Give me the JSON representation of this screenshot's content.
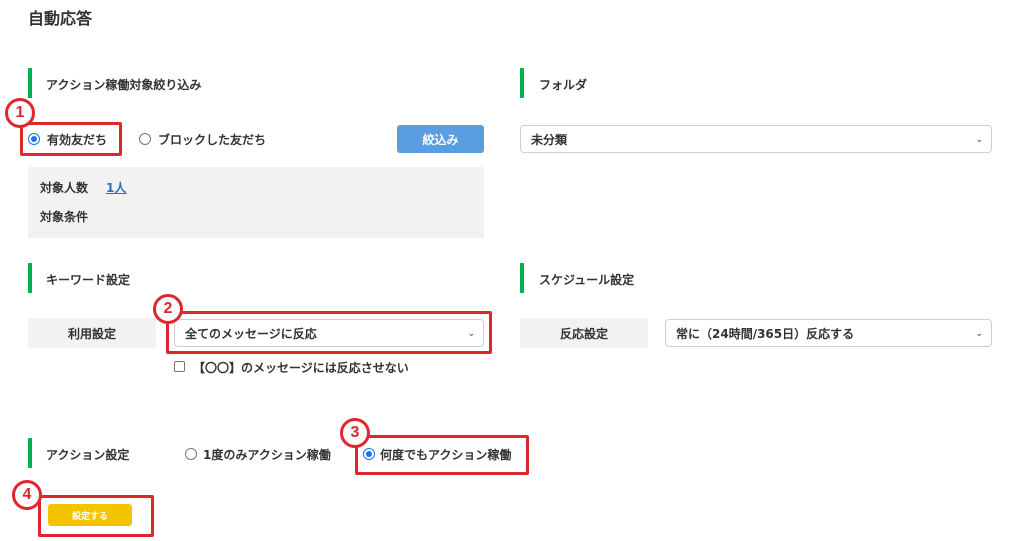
{
  "page": {
    "title": "自動応答"
  },
  "filter_section": {
    "title": "アクション稼働対象絞り込み",
    "radio_valid_friends": "有効友だち",
    "radio_blocked_friends": "ブロックした友だち",
    "filter_button": "絞込み",
    "target_count_label": "対象人数",
    "target_count_value": "1人",
    "target_condition_label": "対象条件"
  },
  "folder_section": {
    "title": "フォルダ",
    "selected": "未分類"
  },
  "keyword_section": {
    "title": "キーワード設定",
    "usage_label": "利用設定",
    "selected": "全てのメッセージに反応",
    "checkbox_label": "【〇〇】のメッセージには反応させない"
  },
  "schedule_section": {
    "title": "スケジュール設定",
    "reaction_label": "反応設定",
    "selected": "常に（24時間/365日）反応する"
  },
  "action_section": {
    "title": "アクション設定",
    "radio_once": "1度のみアクション稼働",
    "radio_any": "何度でもアクション稼働",
    "submit_button": "設定する"
  },
  "annotations": {
    "n1": "1",
    "n2": "2",
    "n3": "3",
    "n4": "4"
  },
  "colors": {
    "accent_green": "#00b14f",
    "annotation_red": "#e0262d",
    "button_blue": "#5a9de0",
    "button_yellow": "#f5c400"
  },
  "icons": [
    "chevron-down-icon"
  ]
}
